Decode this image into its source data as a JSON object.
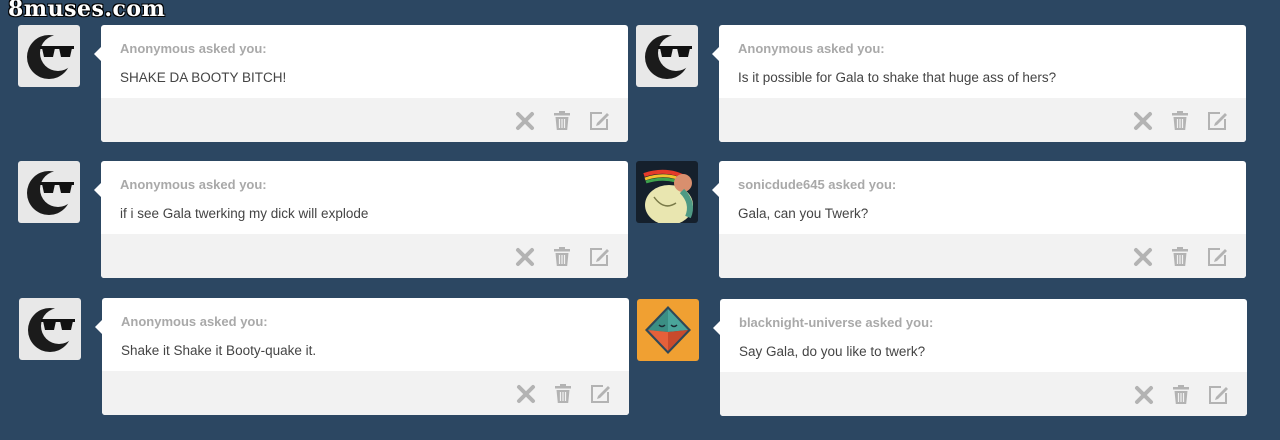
{
  "watermark": "8muses.com",
  "posts": [
    {
      "asker": "Anonymous asked you:",
      "question": "SHAKE DA BOOTY BITCH!",
      "avatar": "sunglasses-moon-avatar"
    },
    {
      "asker": "Anonymous asked you:",
      "question": "Is it possible for Gala to shake that huge ass of hers?",
      "avatar": "sunglasses-moon-avatar"
    },
    {
      "asker": "Anonymous asked you:",
      "question": "if i see Gala twerking my dick will explode",
      "avatar": "sunglasses-moon-avatar"
    },
    {
      "asker": "sonicdude645 asked you:",
      "question": "Gala, can you Twerk?",
      "avatar": "cartoon-artwork-avatar"
    },
    {
      "asker": "Anonymous asked you:",
      "question": "Shake it Shake it Booty-quake it.",
      "avatar": "sunglasses-moon-avatar"
    },
    {
      "asker": "blacknight-universe asked you:",
      "question": "Say Gala, do you like to twerk?",
      "avatar": "diamond-logo-avatar"
    }
  ],
  "controls": [
    "delete-x-icon",
    "trash-icon",
    "edit-icon"
  ],
  "colors": {
    "background": "#2c4762",
    "card": "#ffffff",
    "footer": "#f2f2f2",
    "asker_text": "#a9a9a9",
    "icon": "#b3b3b3",
    "diamond_avatar_bg": "#f0a032"
  }
}
